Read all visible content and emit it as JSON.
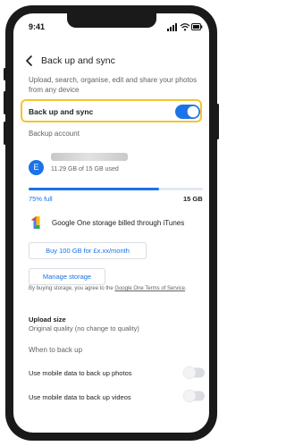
{
  "status": {
    "time": "9:41"
  },
  "header": {
    "title": "Back up and sync"
  },
  "intro": "Upload, search, organise, edit and share your photos from any device",
  "backup_toggle": {
    "label": "Back up and sync",
    "on": true
  },
  "account": {
    "section_label": "Backup account",
    "avatar_letter": "E",
    "usage": "11.29 GB of 15 GB used"
  },
  "storage": {
    "fraction_full": 0.75,
    "percent_label": "75% full",
    "total_label": "15 GB"
  },
  "google_one": {
    "text": "Google One storage billed through iTunes",
    "buy_button": "Buy 100 GB for £x.xx/month",
    "manage_button": "Manage storage",
    "terms_prefix": "By buying storage, you agree to the ",
    "terms_link": "Google One Terms of Service",
    "terms_suffix": "."
  },
  "upload_size": {
    "title": "Upload size",
    "value": "Original quality (no change to quality)"
  },
  "when": {
    "section_label": "When to back up",
    "rows": [
      {
        "label": "Use mobile data to back up photos",
        "on": false
      },
      {
        "label": "Use mobile data to back up videos",
        "on": false
      }
    ]
  },
  "colors": {
    "accent": "#1a73e8",
    "highlight": "#f4c430",
    "text": "#202124",
    "muted": "#5f6368"
  }
}
